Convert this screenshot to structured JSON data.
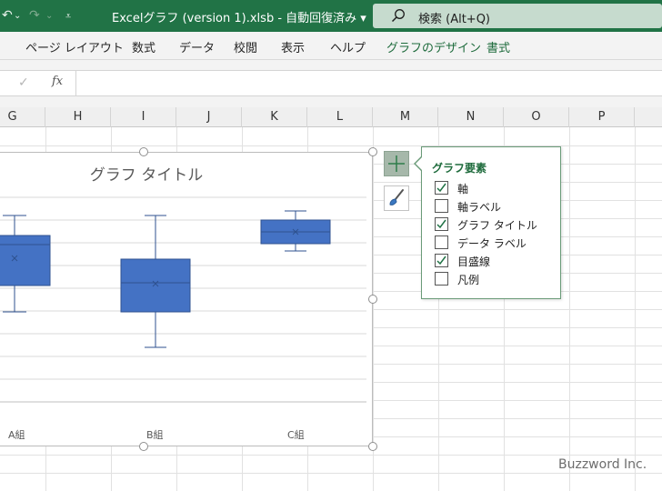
{
  "titlebar": {
    "title": "Excelグラフ (version 1).xlsb  -  自動回復済み  ▾",
    "search_placeholder": "検索 (Alt+Q)",
    "qat": {
      "undo": "↶",
      "redo": "↷",
      "undo_dd": "⌄",
      "redo_dd": "⌄",
      "customize": "⩡"
    },
    "colors": {
      "bar": "#217346",
      "search": "#c6dbce"
    }
  },
  "ribbon": {
    "tabs": [
      "ページ レイアウト",
      "数式",
      "データ",
      "校閲",
      "表示",
      "ヘルプ",
      "グラフのデザイン",
      "書式"
    ]
  },
  "formula_bar": {
    "confirm": "✓",
    "fx": "fx",
    "value": ""
  },
  "columns": [
    "G",
    "H",
    "I",
    "J",
    "K",
    "L",
    "M",
    "N",
    "O",
    "P"
  ],
  "chart_data": {
    "type": "box",
    "title": "グラフ タイトル",
    "categories": [
      "A組",
      "B組",
      "C組"
    ],
    "color": "#4472c4",
    "gridlines": true
  },
  "chart_elements": {
    "title": "グラフ要素",
    "items": [
      {
        "label": "軸",
        "checked": true
      },
      {
        "label": "軸ラベル",
        "checked": false
      },
      {
        "label": "グラフ タイトル",
        "checked": true
      },
      {
        "label": "データ ラベル",
        "checked": false
      },
      {
        "label": "目盛線",
        "checked": true
      },
      {
        "label": "凡例",
        "checked": false
      }
    ]
  },
  "watermark": "Buzzword Inc."
}
